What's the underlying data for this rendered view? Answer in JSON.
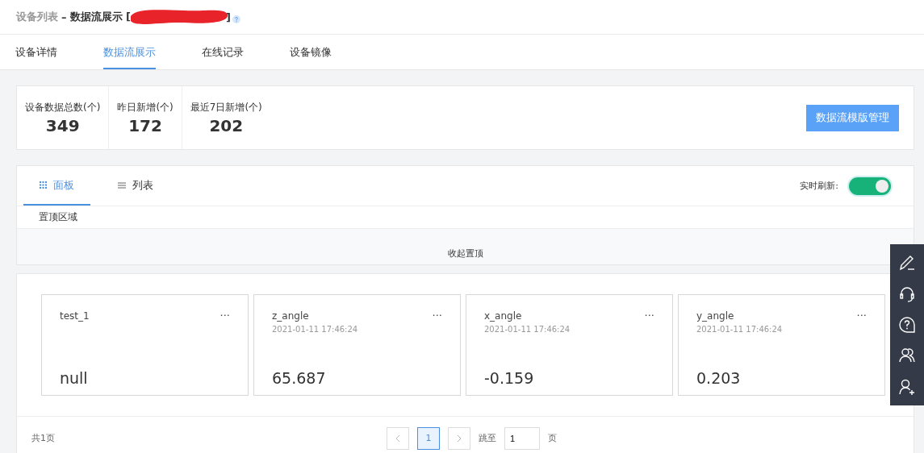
{
  "breadcrumb": {
    "parent": "设备列表",
    "separator": "–",
    "current": "数据流展示 [",
    "closing": "]"
  },
  "tabs": [
    {
      "label": "设备详情",
      "selected": false
    },
    {
      "label": "数据流展示",
      "selected": true
    },
    {
      "label": "在线记录",
      "selected": false
    },
    {
      "label": "设备镜像",
      "selected": false
    }
  ],
  "stats": [
    {
      "label": "设备数据总数(个)",
      "value": "349"
    },
    {
      "label": "昨日新增(个)",
      "value": "172"
    },
    {
      "label": "最近7日新增(个)",
      "value": "202"
    }
  ],
  "template_button": "数据流模版管理",
  "view_tabs": [
    {
      "label": "面板",
      "kind": "grid",
      "selected": true
    },
    {
      "label": "列表",
      "kind": "list",
      "selected": false
    }
  ],
  "realtime": {
    "label": "实时刷新:",
    "on": true
  },
  "pinned_area": {
    "title": "置顶区域",
    "collapse": "收起置顶"
  },
  "streams": [
    {
      "name": "test_1",
      "value": "null"
    },
    {
      "name": "z_angle",
      "time": "2021-01-11 17:46:24",
      "value": "65.687"
    },
    {
      "name": "x_angle",
      "time": "2021-01-11 17:46:24",
      "value": "-0.159"
    },
    {
      "name": "y_angle",
      "time": "2021-01-11 17:46:24",
      "value": "0.203"
    }
  ],
  "more_symbol": "···",
  "pagination": {
    "total": "共1页",
    "pages": [
      {
        "label": "1",
        "selected": true
      }
    ],
    "jump_label": "跳至",
    "jump_value": "1",
    "page_unit": "页"
  },
  "side_tools": [
    {
      "kind": "edit"
    },
    {
      "kind": "support"
    },
    {
      "kind": "help"
    },
    {
      "kind": "users"
    },
    {
      "kind": "add-user"
    }
  ]
}
